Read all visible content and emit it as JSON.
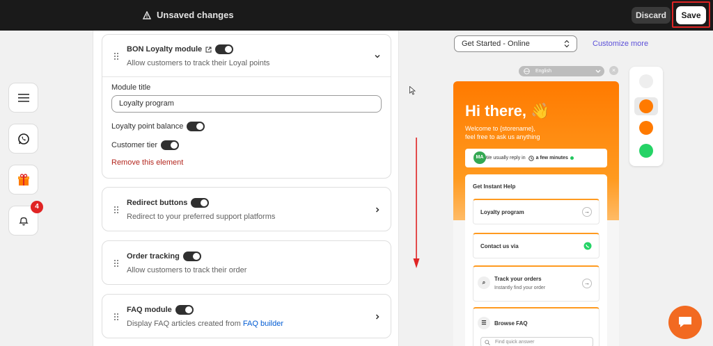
{
  "topbar": {
    "status_text": "Unsaved changes",
    "discard_label": "Discard",
    "save_label": "Save"
  },
  "rail": {
    "items": [
      {
        "icon": "menu-icon"
      },
      {
        "icon": "whatsapp-icon"
      },
      {
        "icon": "gift-icon"
      },
      {
        "icon": "bell-icon",
        "badge": "4"
      }
    ]
  },
  "cards": {
    "loyalty": {
      "title": "BON Loyalty module",
      "description": "Allow customers to track their Loyal points",
      "module_title_label": "Module title",
      "module_title_value": "Loyalty program",
      "balance_label": "Loyalty point balance",
      "tier_label": "Customer tier",
      "remove_label": "Remove this element"
    },
    "redirect": {
      "title": "Redirect buttons",
      "description": "Redirect to your preferred support platforms"
    },
    "order": {
      "title": "Order tracking",
      "description": "Allow customers to track their order"
    },
    "faq": {
      "title": "FAQ module",
      "description": "Display FAQ articles created from",
      "link": "FAQ builder"
    }
  },
  "preview": {
    "page_select": "Get Started - Online",
    "customize_link": "Customize more",
    "language": "English",
    "widget": {
      "greeting": "Hi there, 👋",
      "welcome_line1": "Welcome to {storename},",
      "welcome_line2": "feel free to ask us anything",
      "avatar": "MA",
      "reply_text": "We usually reply in",
      "reply_time": "a few minutes",
      "help_title": "Get Instant Help",
      "items": {
        "loyalty": "Loyalty program",
        "contact": "Contact us via",
        "track": "Track your orders",
        "track_sub": "Instantly find your order",
        "faq": "Browse FAQ",
        "faq_placeholder": "Find quick answer"
      }
    }
  },
  "colors": {
    "topbar": "#1a1a1a",
    "accent_orange": "#ff7a00",
    "link_blue": "#005bd3",
    "remove_red": "#b3261e",
    "highlight_red": "#e02424"
  }
}
